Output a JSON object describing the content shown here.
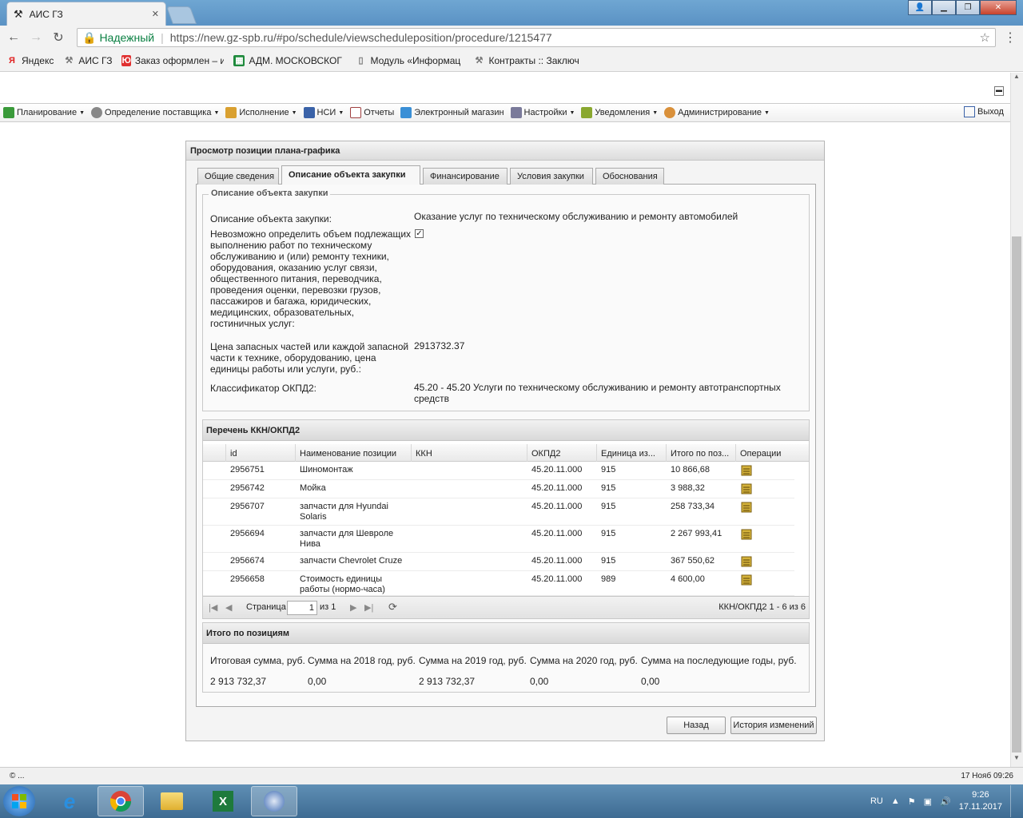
{
  "browser": {
    "tab_title": "АИС ГЗ",
    "secure_label": "Надежный",
    "url": "https://new.gz-spb.ru/#po/schedule/viewscheduleposition/procedure/1215477"
  },
  "bookmarks": [
    {
      "label": "Яндекс",
      "icon": "yandex-icon"
    },
    {
      "label": "АИС ГЗ",
      "icon": "ais-icon"
    },
    {
      "label": "Заказ оформлен – и",
      "icon": "yu-icon"
    },
    {
      "label": "АДМ. МОСКОВСКОГ",
      "icon": "sheet-icon"
    },
    {
      "label": "Модуль «Информац",
      "icon": "page-icon"
    },
    {
      "label": "Контракты :: Заключ",
      "icon": "ais-icon"
    }
  ],
  "menu": {
    "items": [
      "Планирование",
      "Определение поставщика",
      "Исполнение",
      "НСИ",
      "Отчеты",
      "Электронный магазин",
      "Настройки",
      "Уведомления",
      "Администрирование"
    ],
    "logout": "Выход"
  },
  "panel": {
    "title": "Просмотр позиции плана-графика",
    "tabs": [
      "Общие сведения",
      "Описание объекта закупки",
      "Финансирование",
      "Условия закупки",
      "Обоснования"
    ],
    "legend": "Описание объекта закупки",
    "fields": {
      "desc_label": "Описание объекта закупки:",
      "desc_value": "Оказание услуг по техническому обслуживанию и ремонту автомобилей",
      "impossible_label": "Невозможно определить объем подлежащих выполнению работ по техническому обслуживанию и (или) ремонту техники, оборудования, оказанию услуг связи, общественного питания, переводчика, проведения оценки, перевозки грузов, пассажиров и багажа, юридических, медицинских, образовательных, гостиничных услуг:",
      "impossible_checked": true,
      "price_label": "Цена запасных частей или каждой запасной части к технике, оборудованию, цена единицы работы или услуги, руб.:",
      "price_value": "2913732.37",
      "okpd_label": "Классификатор ОКПД2:",
      "okpd_value": "45.20 - 45.20 Услуги по техническому обслуживанию и ремонту автотранспортных средств"
    },
    "grid": {
      "title": "Перечень ККН/ОКПД2",
      "columns": [
        "id",
        "Наименование позиции",
        "ККН",
        "ОКПД2",
        "Единица из...",
        "Итого по поз...",
        "Операции"
      ],
      "rows": [
        {
          "id": "2956751",
          "name": "Шиномонтаж",
          "kkn": "",
          "okpd": "45.20.11.000",
          "unit": "915",
          "total": "10 866,68"
        },
        {
          "id": "2956742",
          "name": "Мойка",
          "kkn": "",
          "okpd": "45.20.11.000",
          "unit": "915",
          "total": "3 988,32"
        },
        {
          "id": "2956707",
          "name": "запчасти для Hyundai Solaris",
          "kkn": "",
          "okpd": "45.20.11.000",
          "unit": "915",
          "total": "258 733,34"
        },
        {
          "id": "2956694",
          "name": "запчасти для Шевроле Нива",
          "kkn": "",
          "okpd": "45.20.11.000",
          "unit": "915",
          "total": "2 267 993,41"
        },
        {
          "id": "2956674",
          "name": "запчасти Chevrolet Cruze",
          "kkn": "",
          "okpd": "45.20.11.000",
          "unit": "915",
          "total": "367 550,62"
        },
        {
          "id": "2956658",
          "name": "Стоимость единицы работы (нормо-часа)",
          "kkn": "",
          "okpd": "45.20.11.000",
          "unit": "989",
          "total": "4 600,00"
        }
      ],
      "pager": {
        "page_label": "Страница",
        "page_value": "1",
        "of_label": "из 1",
        "summary": "ККН/ОКПД2 1 - 6 из 6"
      }
    },
    "totals": {
      "title": "Итого по позициям",
      "headers": [
        "Итоговая сумма, руб.",
        "Сумма на 2018 год, руб.",
        "Сумма на 2019 год, руб.",
        "Сумма на 2020 год, руб.",
        "Сумма на последующие годы, руб."
      ],
      "values": [
        "2 913 732,37",
        "0,00",
        "2 913 732,37",
        "0,00",
        "0,00"
      ]
    },
    "buttons": {
      "back": "Назад",
      "history": "История изменений"
    }
  },
  "status": {
    "left": "© ...",
    "right": "17 Нояб 09:26"
  },
  "taskbar": {
    "lang": "RU",
    "time": "9:26",
    "date": "17.11.2017"
  },
  "colors": {
    "secure": "#0b8043",
    "taskbar": "#4a7aa3"
  }
}
